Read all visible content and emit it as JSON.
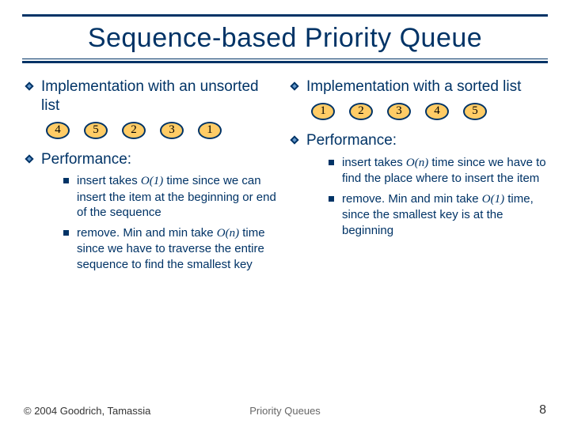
{
  "title": "Sequence-based Priority Queue",
  "left": {
    "heading": "Implementation with an unsorted list",
    "nodes": [
      "4",
      "5",
      "2",
      "3",
      "1"
    ],
    "perf_heading": "Performance:",
    "perf": [
      {
        "pre": "insert takes ",
        "bigO": "O(1)",
        "post": " time since we can insert the item at the beginning or end of the sequence"
      },
      {
        "pre": "remove. Min and min take ",
        "bigO": "O(n)",
        "post": " time since we have to traverse the entire sequence to find the smallest key"
      }
    ]
  },
  "right": {
    "heading": "Implementation with a sorted list",
    "nodes": [
      "1",
      "2",
      "3",
      "4",
      "5"
    ],
    "perf_heading": "Performance:",
    "perf": [
      {
        "pre": "insert takes ",
        "bigO": "O(n)",
        "post": " time since we have to find the place where to insert the item"
      },
      {
        "pre": "remove. Min and min take ",
        "bigO": "O(1)",
        "post": " time, since the smallest key is at the beginning"
      }
    ]
  },
  "footer": {
    "left": "© 2004 Goodrich, Tamassia",
    "center": "Priority Queues",
    "right": "8"
  }
}
